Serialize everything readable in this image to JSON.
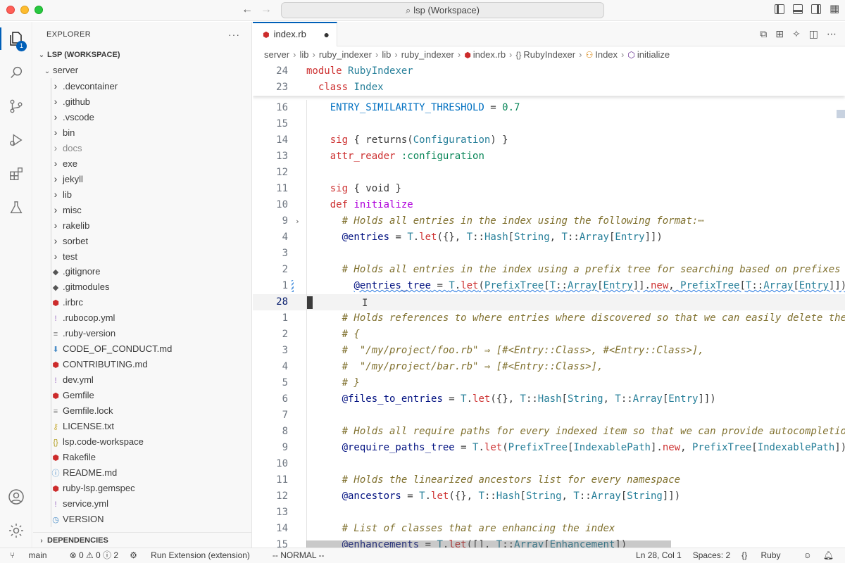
{
  "window": {
    "title": "lsp (Workspace)"
  },
  "activity_bar": {
    "badge": "1"
  },
  "explorer": {
    "header": "EXPLORER",
    "more": "···",
    "workspace": "LSP (WORKSPACE)",
    "root_folder": "server",
    "items": [
      {
        "name": ".devcontainer",
        "type": "folder"
      },
      {
        "name": ".github",
        "type": "folder"
      },
      {
        "name": ".vscode",
        "type": "folder"
      },
      {
        "name": "bin",
        "type": "folder"
      },
      {
        "name": "docs",
        "type": "folder",
        "dim": true
      },
      {
        "name": "exe",
        "type": "folder"
      },
      {
        "name": "jekyll",
        "type": "folder"
      },
      {
        "name": "lib",
        "type": "folder"
      },
      {
        "name": "misc",
        "type": "folder"
      },
      {
        "name": "rakelib",
        "type": "folder"
      },
      {
        "name": "sorbet",
        "type": "folder"
      },
      {
        "name": "test",
        "type": "folder"
      },
      {
        "name": ".gitignore",
        "type": "file",
        "icon": "◆",
        "color": "#555555"
      },
      {
        "name": ".gitmodules",
        "type": "file",
        "icon": "◆",
        "color": "#555555"
      },
      {
        "name": ".irbrc",
        "type": "file",
        "icon": "⬢",
        "color": "#cc2b2b"
      },
      {
        "name": ".rubocop.yml",
        "type": "file",
        "icon": "!",
        "color": "#a074c4"
      },
      {
        "name": ".ruby-version",
        "type": "file",
        "icon": "≡",
        "color": "#888888"
      },
      {
        "name": "CODE_OF_CONDUCT.md",
        "type": "file",
        "icon": "⬇",
        "color": "#4d8fc8"
      },
      {
        "name": "CONTRIBUTING.md",
        "type": "file",
        "icon": "⬢",
        "color": "#cc2b2b"
      },
      {
        "name": "dev.yml",
        "type": "file",
        "icon": "!",
        "color": "#a074c4"
      },
      {
        "name": "Gemfile",
        "type": "file",
        "icon": "⬢",
        "color": "#cc2b2b"
      },
      {
        "name": "Gemfile.lock",
        "type": "file",
        "icon": "≡",
        "color": "#888888"
      },
      {
        "name": "LICENSE.txt",
        "type": "file",
        "icon": "⚷",
        "color": "#cbb142"
      },
      {
        "name": "lsp.code-workspace",
        "type": "file",
        "icon": "{}",
        "color": "#b29f22"
      },
      {
        "name": "Rakefile",
        "type": "file",
        "icon": "⬢",
        "color": "#cc2b2b"
      },
      {
        "name": "README.md",
        "type": "file",
        "icon": "ⓘ",
        "color": "#4d8fc8"
      },
      {
        "name": "ruby-lsp.gemspec",
        "type": "file",
        "icon": "⬢",
        "color": "#cc2b2b"
      },
      {
        "name": "service.yml",
        "type": "file",
        "icon": "!",
        "color": "#a074c4"
      },
      {
        "name": "VERSION",
        "type": "file",
        "icon": "◷",
        "color": "#4d8fc8"
      }
    ],
    "dependencies": "DEPENDENCIES"
  },
  "tab": {
    "label": "index.rb",
    "dirty": "●"
  },
  "breadcrumb": [
    "server",
    "lib",
    "ruby_indexer",
    "lib",
    "ruby_indexer",
    "index.rb",
    "RubyIndexer",
    "Index",
    "initialize"
  ],
  "code": {
    "sticky": [
      {
        "ln": "24",
        "html": "<span class='kw2'>module</span> <span class='cls'>RubyIndexer</span>"
      },
      {
        "ln": "23",
        "html": "  <span class='kw2'>class</span> <span class='cls'>Index</span>"
      }
    ],
    "lines": [
      {
        "ln": "16",
        "html": "    <span class='const'>ENTRY_SIMILARITY_THRESHOLD</span> = <span class='num'>0.7</span>"
      },
      {
        "ln": "15",
        "html": ""
      },
      {
        "ln": "14",
        "html": "    <span class='kw2'>sig</span> { returns(<span class='tcons'>Configuration</span>) }"
      },
      {
        "ln": "13",
        "html": "    <span class='kw2'>attr_reader</span> <span class='sym'>:configuration</span>"
      },
      {
        "ln": "12",
        "html": ""
      },
      {
        "ln": "11",
        "html": "    <span class='kw2'>sig</span> { void }"
      },
      {
        "ln": "10",
        "html": "    <span class='kw2'>def</span> <span class='kw'>initialize</span>"
      },
      {
        "ln": "9",
        "html": "      <span class='com'># Holds all entries in the index using the following format:⋯</span>",
        "fold": true
      },
      {
        "ln": "4",
        "html": "      <span class='ivar'>@entries</span> = <span class='tcons'>T</span>.<span class='kw2'>let</span>({}, <span class='tcons'>T</span>::<span class='tcons'>Hash</span>[<span class='tcons'>String</span>, <span class='tcons'>T</span>::<span class='tcons'>Array</span>[<span class='tcons'>Entry</span>]])"
      },
      {
        "ln": "3",
        "html": ""
      },
      {
        "ln": "2",
        "html": "      <span class='com'># Holds all entries in the index using a prefix tree for searching based on prefixes</span>"
      },
      {
        "ln": "1",
        "html": "        <span class='squiggle'><span class='ivar'>@entries_tree</span> = <span class='tcons'>T</span>.<span class='kw2'>let</span>(<span class='tcons'>PrefixTree</span>[<span class='tcons'>T</span>::<span class='tcons'>Array</span>[<span class='tcons'>Entry</span>]].<span class='kw2'>new</span>, <span class='tcons'>PrefixTree</span>[<span class='tcons'>T</span>::<span class='tcons'>Array</span>[<span class='tcons'>Entry</span>]])</span>",
        "modified": true
      },
      {
        "ln": "28",
        "html": "",
        "current": true
      },
      {
        "ln": "1",
        "html": "      <span class='com'># Holds references to where entries where discovered so that we can easily delete them</span>"
      },
      {
        "ln": "2",
        "html": "      <span class='com'># {</span>"
      },
      {
        "ln": "3",
        "html": "      <span class='com'>#  \"/my/project/foo.rb\" ⇒ [#&lt;Entry::Class&gt;, #&lt;Entry::Class&gt;],</span>"
      },
      {
        "ln": "4",
        "html": "      <span class='com'>#  \"/my/project/bar.rb\" ⇒ [#&lt;Entry::Class&gt;],</span>"
      },
      {
        "ln": "5",
        "html": "      <span class='com'># }</span>"
      },
      {
        "ln": "6",
        "html": "      <span class='ivar'>@files_to_entries</span> = <span class='tcons'>T</span>.<span class='kw2'>let</span>({}, <span class='tcons'>T</span>::<span class='tcons'>Hash</span>[<span class='tcons'>String</span>, <span class='tcons'>T</span>::<span class='tcons'>Array</span>[<span class='tcons'>Entry</span>]])"
      },
      {
        "ln": "7",
        "html": ""
      },
      {
        "ln": "8",
        "html": "      <span class='com'># Holds all require paths for every indexed item so that we can provide autocompletion</span>"
      },
      {
        "ln": "9",
        "html": "      <span class='ivar'>@require_paths_tree</span> = <span class='tcons'>T</span>.<span class='kw2'>let</span>(<span class='tcons'>PrefixTree</span>[<span class='tcons'>IndexablePath</span>].<span class='kw2'>new</span>, <span class='tcons'>PrefixTree</span>[<span class='tcons'>IndexablePath</span>])"
      },
      {
        "ln": "10",
        "html": ""
      },
      {
        "ln": "11",
        "html": "      <span class='com'># Holds the linearized ancestors list for every namespace</span>"
      },
      {
        "ln": "12",
        "html": "      <span class='ivar'>@ancestors</span> = <span class='tcons'>T</span>.<span class='kw2'>let</span>({}, <span class='tcons'>T</span>::<span class='tcons'>Hash</span>[<span class='tcons'>String</span>, <span class='tcons'>T</span>::<span class='tcons'>Array</span>[<span class='tcons'>String</span>]])"
      },
      {
        "ln": "13",
        "html": ""
      },
      {
        "ln": "14",
        "html": "      <span class='com'># List of classes that are enhancing the index</span>"
      },
      {
        "ln": "15",
        "html": "      <span class='ivar'>@enhancements</span> = <span class='tcons'>T</span>.<span class='kw2'>let</span>([], <span class='tcons'>T</span>::<span class='tcons'>Array</span>[<span class='tcons'>Enhancement</span>])"
      }
    ]
  },
  "status": {
    "branch": "main",
    "problems": "⊗ 0 ⚠ 0 ⓘ 2",
    "run": "Run Extension (extension)",
    "vim_mode": "-- NORMAL --",
    "position": "Ln 28, Col 1",
    "spaces": "Spaces: 2",
    "language": "Ruby",
    "lang_icon": "{}"
  },
  "colors": {
    "accent": "#005fb8",
    "ruby": "#cc2b2b"
  }
}
